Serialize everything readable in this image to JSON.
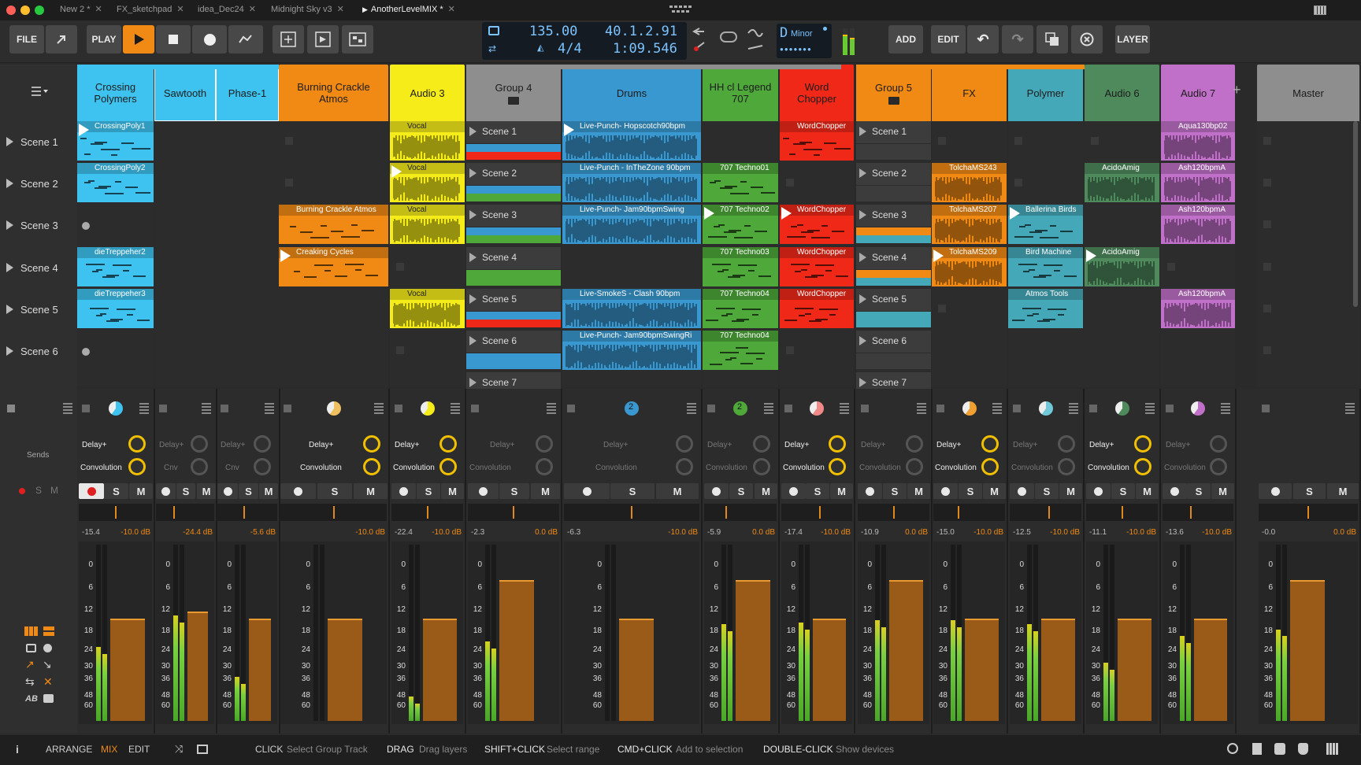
{
  "window": {
    "tabs": [
      {
        "label": "New 2 *",
        "active": false
      },
      {
        "label": "FX_sketchpad",
        "active": false
      },
      {
        "label": "idea_Dec24",
        "active": false
      },
      {
        "label": "Midnight Sky v3",
        "active": false
      },
      {
        "label": "AnotherLevelMIX *",
        "active": true
      }
    ]
  },
  "toolbar": {
    "file": "FILE",
    "play": "PLAY",
    "add": "ADD",
    "edit": "EDIT",
    "layer": "LAYER"
  },
  "transport": {
    "tempo": "135.00",
    "signature": "4/4",
    "position": "40.1.2.91",
    "time": "1:09.546",
    "key_root": "D",
    "key_scale": "Minor"
  },
  "scenes": [
    "Scene 1",
    "Scene 2",
    "Scene 3",
    "Scene 4",
    "Scene 5",
    "Scene 6"
  ],
  "tracks": [
    {
      "name": "Crossing Polymers",
      "color": "#3ec3f0"
    },
    {
      "name": "Sawtooth",
      "color": "#3ec3f0"
    },
    {
      "name": "Phase-1",
      "color": "#3ec3f0"
    },
    {
      "name": "Burning Crackle Atmos",
      "color": "#f08a14"
    },
    {
      "name": "Audio 3",
      "color": "#f5ec1a"
    },
    {
      "name": "Group 4",
      "color": "#8e8e8e"
    },
    {
      "name": "Drums",
      "color": "#3a98d0"
    },
    {
      "name": "HH cl Legend 707",
      "color": "#4ea83a"
    },
    {
      "name": "Word Chopper",
      "color": "#f02818"
    },
    {
      "name": "Group 5",
      "color": "#f08a14"
    },
    {
      "name": "FX",
      "color": "#f08a14"
    },
    {
      "name": "Polymer",
      "color": "#44a8b8"
    },
    {
      "name": "Audio 6",
      "color": "#4e8a5c"
    },
    {
      "name": "Audio 7",
      "color": "#c070c8"
    },
    {
      "name": "Master",
      "color": "#8e8e8e"
    }
  ],
  "group4_scenes": [
    "Scene 1",
    "Scene 2",
    "Scene 3",
    "Scene 4",
    "Scene 5",
    "Scene 6",
    "Scene 7"
  ],
  "group5_scenes": [
    "Scene 1",
    "Scene 2",
    "Scene 3",
    "Scene 4",
    "Scene 5",
    "Scene 6",
    "Scene 7"
  ],
  "clips": {
    "c0": "CrossingPoly1",
    "c1": "CrossingPoly2",
    "c2": "dieTreppeher2",
    "c3": "dieTreppeher3",
    "c4": "Burning Crackle Atmos",
    "c5": "Creaking Cycles",
    "c6": "Vocal",
    "c7": "Vocal",
    "c8": "Vocal",
    "c9": "Vocal",
    "c10": "Live-Punch- Hopscotch90bpm",
    "c11": "Live-Punch - InTheZone 90bpm",
    "c12": "Live-Punch- Jam90bpmSwing",
    "c13": "Live-SmokeS - Clash 90bpm",
    "c14": "Live-Punch- Jam90bpmSwingRi",
    "c15": "707 Techno01",
    "c16": "707 Techno02",
    "c17": "707 Techno03",
    "c18": "707 Techno04",
    "c19": "707 Techno04",
    "c20": "WordChopper",
    "c21": "WordChopper",
    "c22": "WordChopper",
    "c23": "WordChopper",
    "c24": "TolchaMS243",
    "c25": "TolchaMS207",
    "c26": "TolchaMS209",
    "c27": "Ballerina Birds",
    "c28": "Bird Machine",
    "c29": "Atmos Tools",
    "c30": "AcidoAmig",
    "c31": "AcidoAmig",
    "c32": "Aqua130bp02",
    "c33": "Ash120bpmA",
    "c34": "Ash120bpmA",
    "c35": "Ash120bpmA"
  },
  "sends": {
    "label": "Sends",
    "send1": "Delay+",
    "send2": "Convolution",
    "send2_short": "Cnv"
  },
  "mixer": {
    "solo": "S",
    "mute": "M",
    "levels": [
      {
        "peak": "-15.4",
        "vol": "-10.0 dB"
      },
      {
        "peak": "",
        "vol": "-24.4 dB"
      },
      {
        "peak": "",
        "vol": "-5.6 dB"
      },
      {
        "peak": "",
        "vol": "-10.0 dB"
      },
      {
        "peak": "-22.4",
        "vol": "-10.0 dB"
      },
      {
        "peak": "-2.3",
        "vol": "0.0 dB"
      },
      {
        "peak": "-6.3",
        "vol": "-10.0 dB"
      },
      {
        "peak": "-5.9",
        "vol": "0.0 dB"
      },
      {
        "peak": "-17.4",
        "vol": "-10.0 dB"
      },
      {
        "peak": "-10.9",
        "vol": "0.0 dB"
      },
      {
        "peak": "-15.0",
        "vol": "-10.0 dB"
      },
      {
        "peak": "-12.5",
        "vol": "-10.0 dB"
      },
      {
        "peak": "-11.1",
        "vol": "-10.0 dB"
      },
      {
        "peak": "-13.6",
        "vol": "-10.0 dB"
      },
      {
        "peak": "-0.0",
        "vol": "0.0 dB"
      }
    ],
    "scale": [
      "0",
      "6",
      "12",
      "18",
      "24",
      "30",
      "36",
      "48",
      "60"
    ]
  },
  "badges": {
    "drums": "2",
    "hh": "2"
  },
  "bottombar": {
    "arrange": "ARRANGE",
    "mix": "MIX",
    "edit": "EDIT",
    "hints": [
      {
        "key": "CLICK",
        "desc": "Select Group Track"
      },
      {
        "key": "DRAG",
        "desc": "Drag layers"
      },
      {
        "key": "SHIFT+CLICK",
        "desc": "Select range"
      },
      {
        "key": "CMD+CLICK",
        "desc": "Add to selection"
      },
      {
        "key": "DOUBLE-CLICK",
        "desc": "Show devices"
      }
    ]
  },
  "colors": {
    "accent": "#f08a14",
    "lcd": "#7cc3ff",
    "meter_green": "#6ac832",
    "fader": "#9a5a18"
  }
}
